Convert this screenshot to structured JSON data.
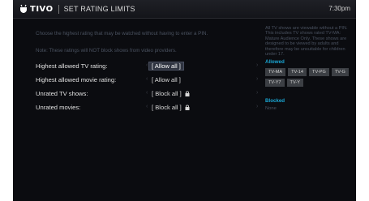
{
  "header": {
    "logo": "TIVO",
    "title": "SET RATING LIMITS",
    "time": "7:30pm"
  },
  "instructions": "Choose the highest rating that may be watched without having to enter a PIN.",
  "note": "Note: These ratings will NOT block shows from video providers.",
  "rows": [
    {
      "label": "Highest allowed TV rating:",
      "value": "[ Allow all ]",
      "locked": false,
      "selected": true
    },
    {
      "label": "Highest allowed movie rating:",
      "value": "[ Allow all ]",
      "locked": false,
      "selected": false
    },
    {
      "label": "Unrated TV shows:",
      "value": "[ Block all ]",
      "locked": true,
      "selected": false
    },
    {
      "label": "Unrated movies:",
      "value": "[ Block all ]",
      "locked": true,
      "selected": false
    }
  ],
  "arrows": {
    "left": "‹",
    "right": "›"
  },
  "panel": {
    "description": "All TV shows are viewable without a PIN. This includes TV shows rated TV-MA: Mature Audience Only. These shows are designed to be viewed by adults and therefore may be unsuitable for children under 17.",
    "allowed_heading": "Allowed",
    "allowed": [
      "TV-MA",
      "TV-14",
      "TV-PG",
      "TV-G",
      "TV-Y7",
      "TV-Y"
    ],
    "blocked_heading": "Blocked",
    "blocked_value": "None"
  },
  "colors": {
    "background": "#0b0c10",
    "accent": "#1aa7d4",
    "chip": "#3c3f44"
  }
}
